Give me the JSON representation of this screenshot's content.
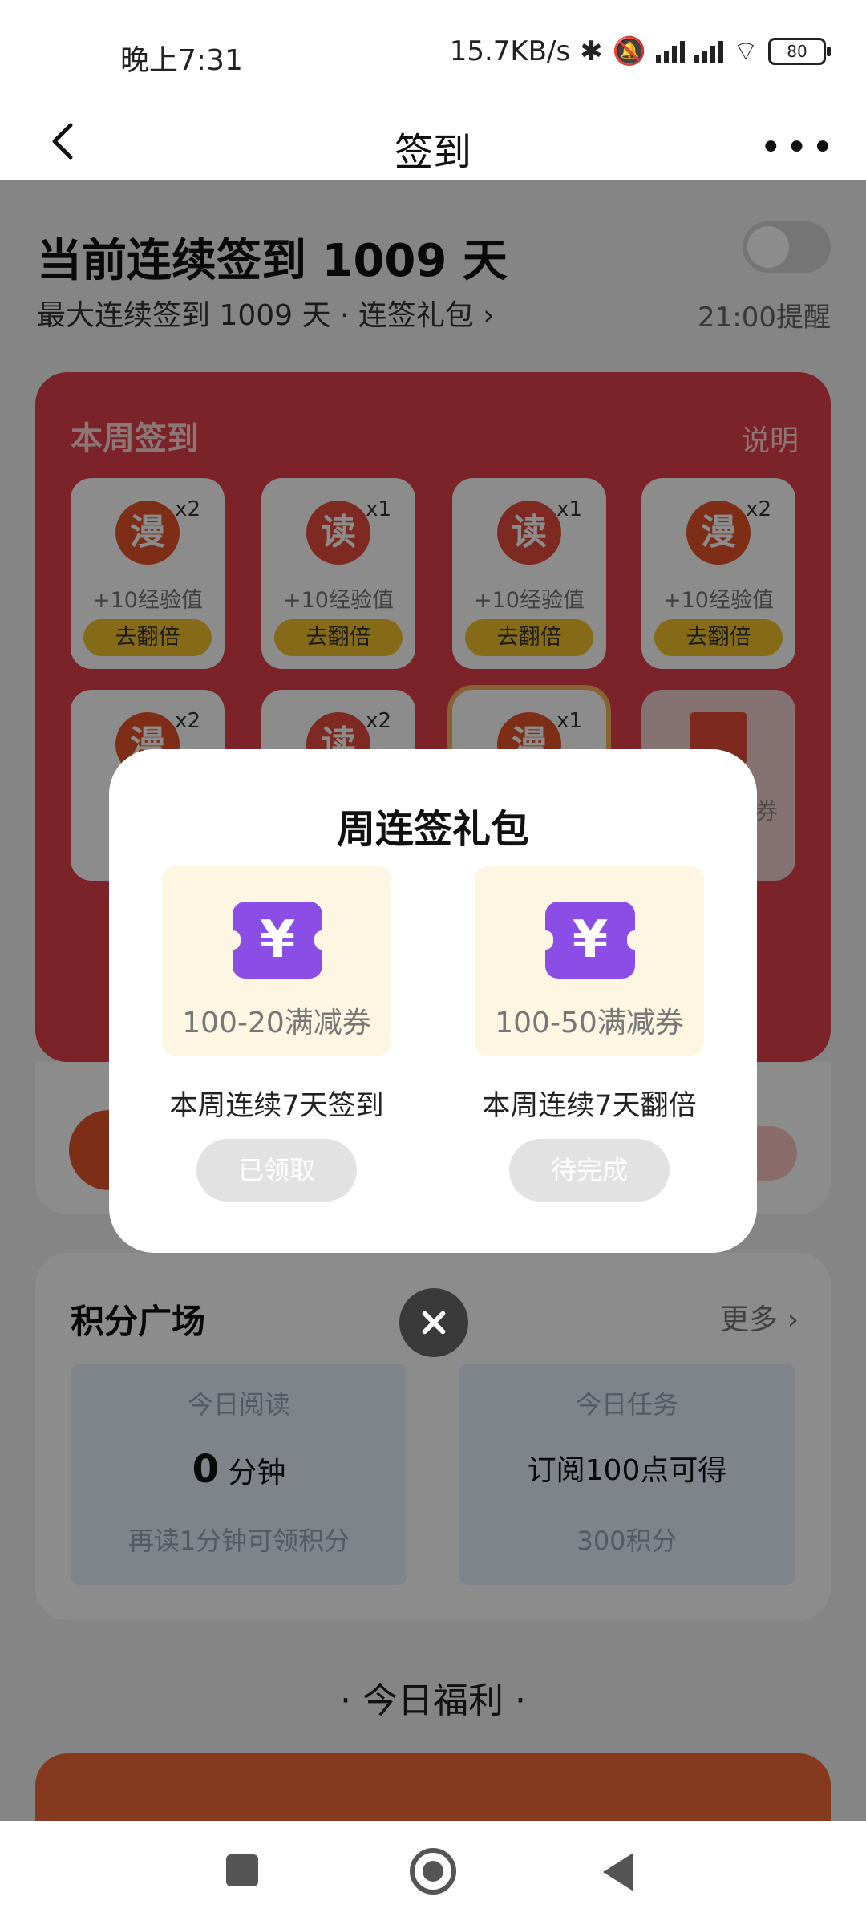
{
  "status_bar": {
    "time": "晚上7:31",
    "speed": "15.7KB/s",
    "battery": "80"
  },
  "nav": {
    "title": "签到"
  },
  "streak": {
    "title": "当前连续签到 1009 天",
    "subtitle": "最大连续签到 1009 天 · 连签礼包 ›",
    "reminder_time": "21:00提醒",
    "reminder_on": false
  },
  "weekly": {
    "title": "本周签到",
    "explain": "说明",
    "days": [
      {
        "icon": "漫",
        "mult": "x2",
        "exp": "+10经验值",
        "action": "去翻倍"
      },
      {
        "icon": "读",
        "mult": "x1",
        "exp": "+10经验值",
        "action": "去翻倍"
      },
      {
        "icon": "读",
        "mult": "x1",
        "exp": "+10经验值",
        "action": "去翻倍"
      },
      {
        "icon": "漫",
        "mult": "x2",
        "exp": "+10经验值",
        "action": "去翻倍"
      },
      {
        "icon": "漫",
        "mult": "x2"
      },
      {
        "icon": "读",
        "mult": "x2"
      },
      {
        "icon": "漫",
        "mult": "x1"
      },
      {
        "label": "券"
      }
    ]
  },
  "points": {
    "title": "积分广场",
    "more": "更多 ›",
    "read": {
      "title": "今日阅读",
      "value": "0",
      "unit": "分钟",
      "sub": "再读1分钟可领积分"
    },
    "task": {
      "title": "今日任务",
      "value": "订阅100点可得",
      "sub": "300积分"
    }
  },
  "today_welfare": "· 今日福利 ·",
  "modal": {
    "title": "周连签礼包",
    "gifts": [
      {
        "coupon_symbol": "¥",
        "name": "100-20满减券",
        "condition": "本周连续7天签到",
        "status": "已领取"
      },
      {
        "coupon_symbol": "¥",
        "name": "100-50满减券",
        "condition": "本周连续7天翻倍",
        "status": "待完成"
      }
    ]
  },
  "colors": {
    "primary_red": "#e0404a",
    "coupon_purple": "#8a4de6",
    "double_yellow": "#f3c42a"
  }
}
